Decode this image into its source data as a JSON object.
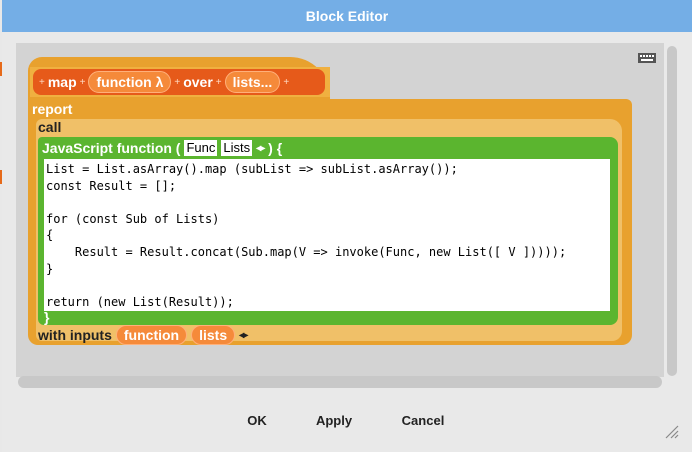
{
  "dialog": {
    "title": "Block Editor"
  },
  "prototype": {
    "words": [
      "map",
      "over"
    ],
    "inputs": [
      "function λ",
      "lists..."
    ]
  },
  "report_label": "report",
  "call_label": "call",
  "js_function": {
    "header_label": "JavaScript function (",
    "params": [
      "Func",
      "Lists"
    ],
    "header_close": ") {",
    "close_brace": "}",
    "code": "List = List.asArray().map (subList => subList.asArray());\nconst Result = [];\n\nfor (const Sub of Lists)\n{\n    Result = Result.concat(Sub.map(V => invoke(Func, new List([ V ]))));\n}\n\nreturn (new List(Result));"
  },
  "with_inputs": {
    "label": "with inputs",
    "inputs": [
      "function",
      "lists"
    ]
  },
  "buttons": {
    "ok": "OK",
    "apply": "Apply",
    "cancel": "Cancel"
  },
  "colors": {
    "title_bar": "#74aee6",
    "operators_orange": "#e65a1a",
    "control_gold": "#e8a12e",
    "other_green": "#5bb52f"
  }
}
